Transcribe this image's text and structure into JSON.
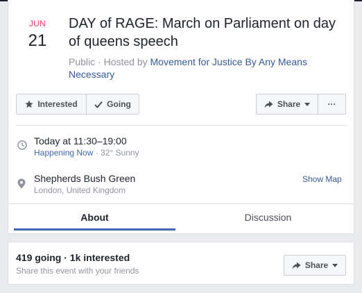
{
  "event": {
    "month": "JUN",
    "day": "21",
    "title": "DAY of RAGE: March on Parliament on day of queens speech",
    "privacy": "Public",
    "hosted_by_prefix": " · Hosted by ",
    "host": "Movement for Justice By Any Means Necessary"
  },
  "actions": {
    "interested_label": "Interested",
    "going_label": "Going",
    "share_label": "Share",
    "more_label": "···"
  },
  "details": {
    "time": "Today at 11:30–19:00",
    "happening_now": "Happening Now",
    "weather": " · 32° Sunny",
    "location": "Shepherds Bush Green",
    "address": "London, United Kingdom",
    "show_map": "Show Map"
  },
  "tabs": [
    {
      "label": "About"
    },
    {
      "label": "Discussion"
    }
  ],
  "stats": {
    "summary": "419 going · 1k interested",
    "share_prompt": "Share this event with your friends",
    "share_label": "Share"
  },
  "colors": {
    "accent": "#4267b2",
    "month": "#f3425f",
    "link": "#365899"
  },
  "icons": [
    "star-icon",
    "check-icon",
    "share-arrow-icon",
    "caret-down-icon",
    "more-icon",
    "clock-icon",
    "map-pin-icon"
  ]
}
